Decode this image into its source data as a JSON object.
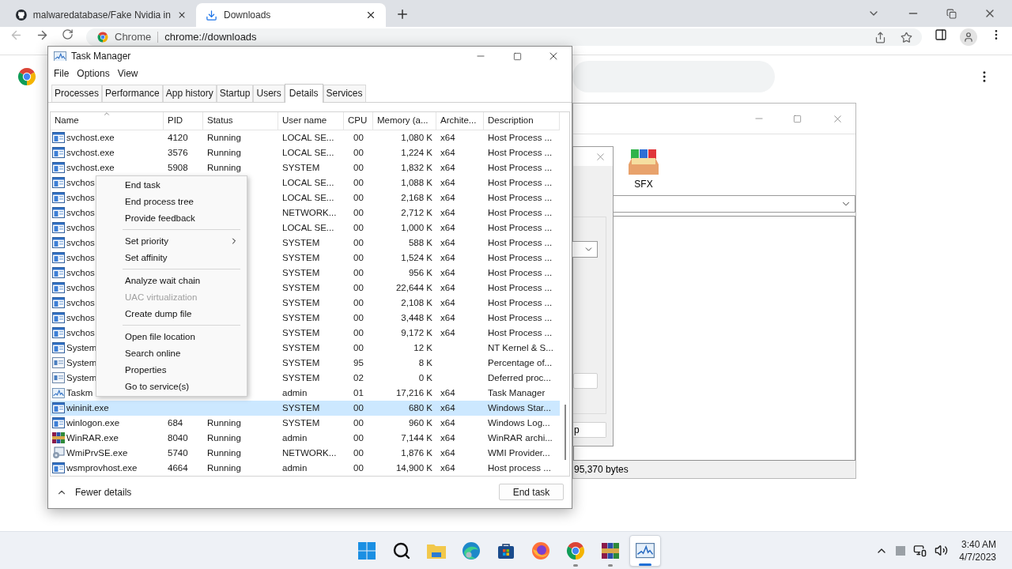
{
  "browser": {
    "tabs": [
      {
        "title": "malwaredatabase/Fake Nvidia in",
        "selected": false,
        "kind": "github"
      },
      {
        "title": "Downloads",
        "selected": true,
        "kind": "download"
      }
    ],
    "address": {
      "site_label": "Chrome",
      "url": "chrome://downloads"
    }
  },
  "winrar_window": {
    "toolbar": [
      {
        "label": "SFX"
      }
    ],
    "status": "95,370 bytes",
    "dialog": {
      "button": "p"
    }
  },
  "task_manager": {
    "title": "Task Manager",
    "menu": [
      "File",
      "Options",
      "View"
    ],
    "tabs": [
      {
        "label": "Processes",
        "selected": false
      },
      {
        "label": "Performance",
        "selected": false
      },
      {
        "label": "App history",
        "selected": false
      },
      {
        "label": "Startup",
        "selected": false
      },
      {
        "label": "Users",
        "selected": false
      },
      {
        "label": "Details",
        "selected": true
      },
      {
        "label": "Services",
        "selected": false
      }
    ],
    "columns": [
      {
        "label": "Name",
        "sorted": true
      },
      {
        "label": "PID",
        "sorted": false
      },
      {
        "label": "Status",
        "sorted": false
      },
      {
        "label": "User name",
        "sorted": false
      },
      {
        "label": "CPU",
        "sorted": false
      },
      {
        "label": "Memory (a...",
        "sorted": false
      },
      {
        "label": "Archite...",
        "sorted": false
      },
      {
        "label": "Description",
        "sorted": false
      }
    ],
    "rows": [
      {
        "kind": "service",
        "name": "svchost.exe",
        "pid": "4120",
        "status": "Running",
        "user": "LOCAL SE...",
        "cpu": "00",
        "memory": "1,080 K",
        "arch": "x64",
        "description": "Host Process ...",
        "selected": false
      },
      {
        "kind": "service",
        "name": "svchost.exe",
        "pid": "3576",
        "status": "Running",
        "user": "LOCAL SE...",
        "cpu": "00",
        "memory": "1,224 K",
        "arch": "x64",
        "description": "Host Process ...",
        "selected": false
      },
      {
        "kind": "service",
        "name": "svchost.exe",
        "pid": "5908",
        "status": "Running",
        "user": "SYSTEM",
        "cpu": "00",
        "memory": "1,832 K",
        "arch": "x64",
        "description": "Host Process ...",
        "selected": false
      },
      {
        "kind": "service",
        "name": "svchos",
        "user": "LOCAL SE...",
        "cpu": "00",
        "memory": "1,088 K",
        "arch": "x64",
        "description": "Host Process ...",
        "selected": false
      },
      {
        "kind": "service",
        "name": "svchos",
        "user": "LOCAL SE...",
        "cpu": "00",
        "memory": "2,168 K",
        "arch": "x64",
        "description": "Host Process ...",
        "selected": false
      },
      {
        "kind": "service",
        "name": "svchos",
        "user": "NETWORK...",
        "cpu": "00",
        "memory": "2,712 K",
        "arch": "x64",
        "description": "Host Process ...",
        "selected": false
      },
      {
        "kind": "service",
        "name": "svchos",
        "user": "LOCAL SE...",
        "cpu": "00",
        "memory": "1,000 K",
        "arch": "x64",
        "description": "Host Process ...",
        "selected": false
      },
      {
        "kind": "service",
        "name": "svchos",
        "user": "SYSTEM",
        "cpu": "00",
        "memory": "588 K",
        "arch": "x64",
        "description": "Host Process ...",
        "selected": false
      },
      {
        "kind": "service",
        "name": "svchos",
        "user": "SYSTEM",
        "cpu": "00",
        "memory": "1,524 K",
        "arch": "x64",
        "description": "Host Process ...",
        "selected": false
      },
      {
        "kind": "service",
        "name": "svchos",
        "user": "SYSTEM",
        "cpu": "00",
        "memory": "956 K",
        "arch": "x64",
        "description": "Host Process ...",
        "selected": false
      },
      {
        "kind": "service",
        "name": "svchos",
        "user": "SYSTEM",
        "cpu": "00",
        "memory": "22,644 K",
        "arch": "x64",
        "description": "Host Process ...",
        "selected": false
      },
      {
        "kind": "service",
        "name": "svchos",
        "user": "SYSTEM",
        "cpu": "00",
        "memory": "2,108 K",
        "arch": "x64",
        "description": "Host Process ...",
        "selected": false
      },
      {
        "kind": "service",
        "name": "svchos",
        "user": "SYSTEM",
        "cpu": "00",
        "memory": "3,448 K",
        "arch": "x64",
        "description": "Host Process ...",
        "selected": false
      },
      {
        "kind": "service",
        "name": "svchos",
        "user": "SYSTEM",
        "cpu": "00",
        "memory": "9,172 K",
        "arch": "x64",
        "description": "Host Process ...",
        "selected": false
      },
      {
        "kind": "service",
        "name": "System",
        "user": "SYSTEM",
        "cpu": "00",
        "memory": "12 K",
        "description": "NT Kernel & S...",
        "selected": false
      },
      {
        "kind": "system",
        "name": "System",
        "user": "SYSTEM",
        "cpu": "95",
        "memory": "8 K",
        "description": "Percentage of...",
        "selected": false
      },
      {
        "kind": "system",
        "name": "System",
        "user": "SYSTEM",
        "cpu": "02",
        "memory": "0 K",
        "description": "Deferred proc...",
        "selected": false
      },
      {
        "kind": "taskmgr",
        "name": "Taskm",
        "user": "admin",
        "cpu": "01",
        "memory": "17,216 K",
        "arch": "x64",
        "description": "Task Manager",
        "selected": false
      },
      {
        "kind": "service",
        "name": "wininit.exe",
        "user": "SYSTEM",
        "cpu": "00",
        "memory": "680 K",
        "arch": "x64",
        "description": "Windows Star...",
        "selected": true
      },
      {
        "kind": "service",
        "name": "winlogon.exe",
        "pid": "684",
        "status": "Running",
        "user": "SYSTEM",
        "cpu": "00",
        "memory": "960 K",
        "arch": "x64",
        "description": "Windows Log...",
        "selected": false
      },
      {
        "kind": "winrar",
        "name": "WinRAR.exe",
        "pid": "8040",
        "status": "Running",
        "user": "admin",
        "cpu": "00",
        "memory": "7,144 K",
        "arch": "x64",
        "description": "WinRAR archi...",
        "selected": false
      },
      {
        "kind": "wmi",
        "name": "WmiPrvSE.exe",
        "pid": "5740",
        "status": "Running",
        "user": "NETWORK...",
        "cpu": "00",
        "memory": "1,876 K",
        "arch": "x64",
        "description": "WMI Provider...",
        "selected": false
      },
      {
        "kind": "service",
        "name": "wsmprovhost.exe",
        "pid": "4664",
        "status": "Running",
        "user": "admin",
        "cpu": "00",
        "memory": "14,900 K",
        "arch": "x64",
        "description": "Host process ...",
        "selected": false
      }
    ],
    "context_menu": [
      {
        "kind": "item",
        "label": "End task",
        "disabled": false
      },
      {
        "kind": "item",
        "label": "End process tree",
        "disabled": false
      },
      {
        "kind": "item",
        "label": "Provide feedback",
        "disabled": false
      },
      {
        "kind": "separator"
      },
      {
        "kind": "submenu",
        "label": "Set priority",
        "disabled": false
      },
      {
        "kind": "item",
        "label": "Set affinity",
        "disabled": false
      },
      {
        "kind": "separator"
      },
      {
        "kind": "item",
        "label": "Analyze wait chain",
        "disabled": false
      },
      {
        "kind": "item",
        "label": "UAC virtualization",
        "disabled": true
      },
      {
        "kind": "item",
        "label": "Create dump file",
        "disabled": false
      },
      {
        "kind": "separator"
      },
      {
        "kind": "item",
        "label": "Open file location",
        "disabled": false
      },
      {
        "kind": "item",
        "label": "Search online",
        "disabled": false
      },
      {
        "kind": "item",
        "label": "Properties",
        "disabled": false
      },
      {
        "kind": "item",
        "label": "Go to service(s)",
        "disabled": false
      }
    ],
    "footer": {
      "toggle": "Fewer details",
      "button": "End task"
    }
  },
  "taskbar": {
    "apps": [
      {
        "kind": "start",
        "running": false,
        "active": false
      },
      {
        "kind": "search",
        "running": false,
        "active": false
      },
      {
        "kind": "explorer",
        "running": false,
        "active": false
      },
      {
        "kind": "edge",
        "running": false,
        "active": false
      },
      {
        "kind": "store",
        "running": false,
        "active": false
      },
      {
        "kind": "firefox",
        "running": false,
        "active": false
      },
      {
        "kind": "chrome",
        "running": true,
        "active": false
      },
      {
        "kind": "winrar",
        "running": true,
        "active": false
      },
      {
        "kind": "taskmgr",
        "running": true,
        "active": true
      }
    ],
    "time": "3:40 AM",
    "date": "4/7/2023"
  }
}
